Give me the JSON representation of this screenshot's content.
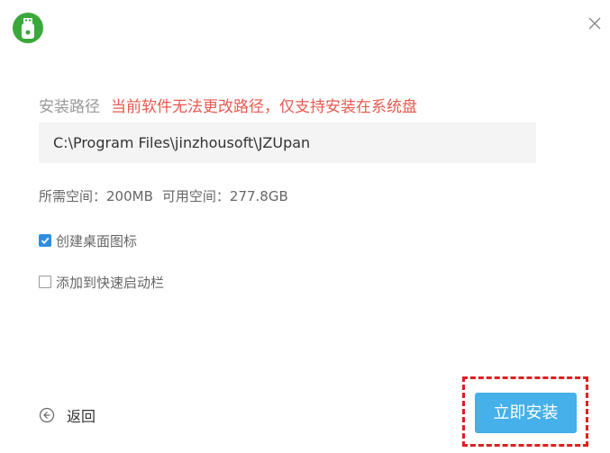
{
  "window": {
    "logo_icon": "usb-drive-icon",
    "close_icon": "close-icon",
    "brand_color": "#3aa83a"
  },
  "install_path": {
    "label": "安装路径",
    "warning": "当前软件无法更改路径，仅支持安装在系统盘",
    "warning_color": "#e85a4f",
    "value": "C:\\Program Files\\jinzhousoft\\JZUpan"
  },
  "space": {
    "required_label": "所需空间：",
    "required_value": "200MB",
    "available_label": "可用空间：",
    "available_value": "277.8GB"
  },
  "options": [
    {
      "label": "创建桌面图标",
      "checked": true
    },
    {
      "label": "添加到快速启动栏",
      "checked": false
    }
  ],
  "footer": {
    "back_icon": "circle-arrow-left-icon",
    "back_label": "返回",
    "install_label": "立即安装",
    "install_color": "#45b0ea",
    "highlight_color": "#e0201c"
  }
}
